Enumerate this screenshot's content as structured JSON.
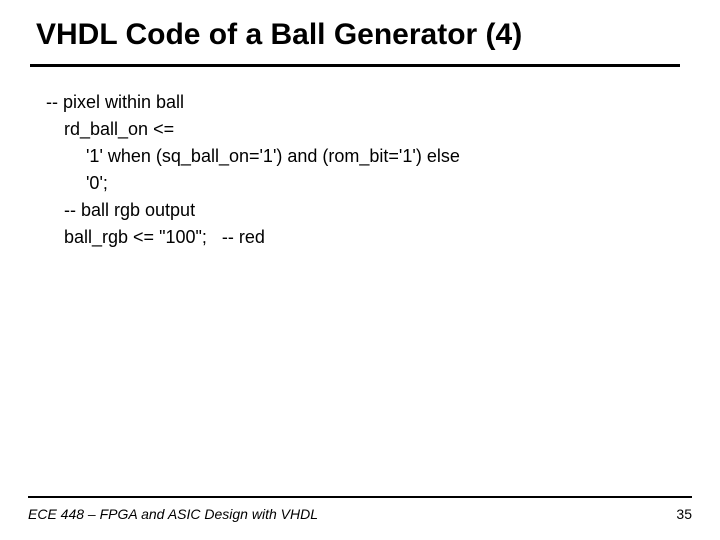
{
  "title": "VHDL Code of a Ball Generator (4)",
  "code": {
    "line1": "-- pixel within ball",
    "line2": "rd_ball_on <=",
    "line3": "'1' when (sq_ball_on='1') and (rom_bit='1') else",
    "line4": "'0';",
    "line5": "-- ball rgb output",
    "line6": "ball_rgb <= \"100\";   -- red"
  },
  "footer": {
    "text": "ECE 448 – FPGA and ASIC Design with VHDL",
    "page": "35"
  }
}
